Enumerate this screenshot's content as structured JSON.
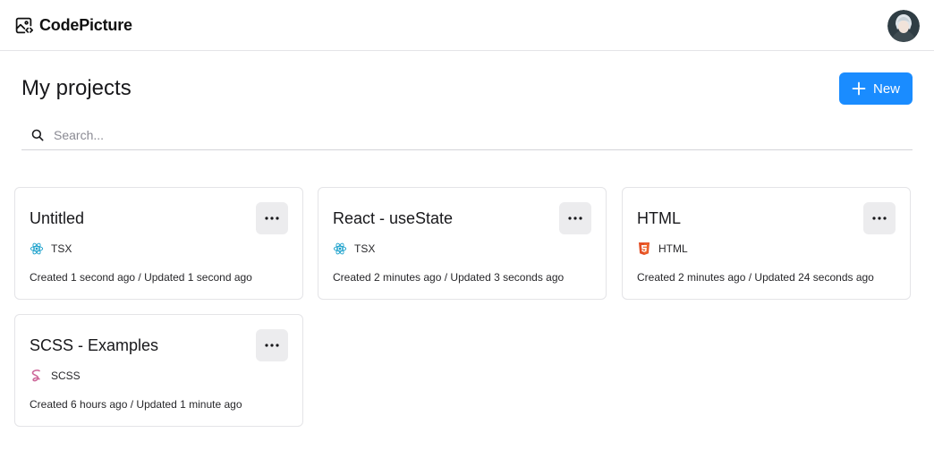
{
  "header": {
    "brand_name": "CodePicture",
    "brand_icon": "image-code-icon",
    "avatar": "user-avatar"
  },
  "main": {
    "title": "My projects",
    "new_button_label": "New",
    "new_button_color": "#1a8cff",
    "search_placeholder": "Search...",
    "search_value": ""
  },
  "projects": [
    {
      "title": "Untitled",
      "language": "TSX",
      "language_icon": "react-icon",
      "meta": "Created 1 second ago / Updated 1 second ago"
    },
    {
      "title": "React - useState",
      "language": "TSX",
      "language_icon": "react-icon",
      "meta": "Created 2 minutes ago / Updated 3 seconds ago"
    },
    {
      "title": "HTML",
      "language": "HTML",
      "language_icon": "html5-icon",
      "meta": "Created 2 minutes ago / Updated 24 seconds ago"
    },
    {
      "title": "SCSS - Examples",
      "language": "SCSS",
      "language_icon": "sass-icon",
      "meta": "Created 6 hours ago / Updated 1 minute ago"
    }
  ],
  "colors": {
    "react": "#149eca",
    "html5": "#e34f26",
    "sass": "#cd6799"
  }
}
